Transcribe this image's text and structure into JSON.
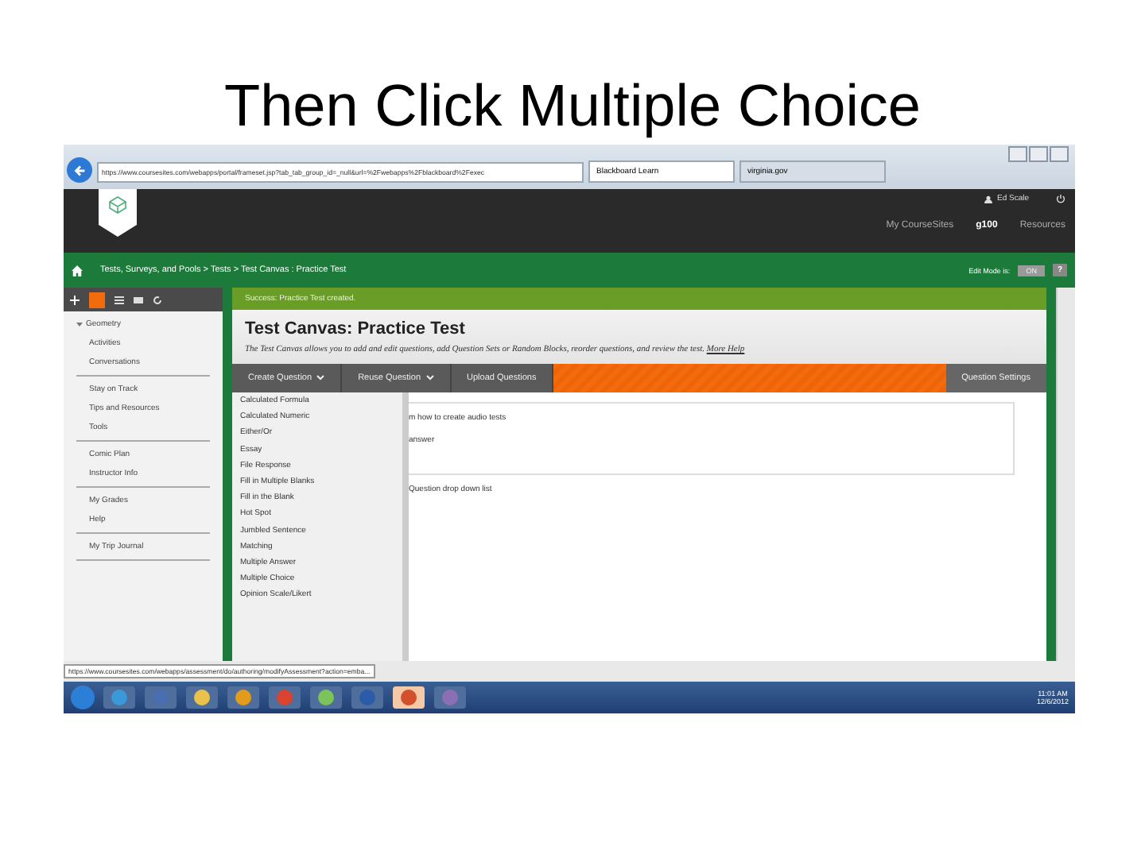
{
  "slide_title": "Then Click Multiple Choice",
  "browser": {
    "url": "https://www.coursesites.com/webapps/portal/frameset.jsp?tab_tab_group_id=_null&url=%2Fwebapps%2Fblackboard%2Fexec",
    "tabs": [
      {
        "label": "Blackboard Learn",
        "selected": true
      },
      {
        "label": "virginia.gov",
        "selected": false
      }
    ]
  },
  "header": {
    "user": "Ed Scale",
    "nav": [
      {
        "label": "My CourseSites",
        "selected": false
      },
      {
        "label": "g100",
        "selected": true
      },
      {
        "label": "Resources",
        "selected": false
      }
    ]
  },
  "breadcrumb": "Tests, Surveys, and Pools  >  Tests  >  Test Canvas : Practice Test",
  "edit_mode": {
    "label": "Edit Mode is:",
    "value": "ON",
    "help": "?"
  },
  "sidebar": {
    "groups": [
      [
        {
          "label": "Geometry",
          "expanded": true,
          "children": [
            {
              "label": "Activities"
            },
            {
              "label": "Conversations"
            }
          ]
        }
      ],
      [
        {
          "label": "Stay on Track"
        },
        {
          "label": "Tips and Resources"
        },
        {
          "label": "Tools"
        }
      ],
      [
        {
          "label": "Comic Plan"
        },
        {
          "label": "Instructor Info"
        }
      ],
      [
        {
          "label": "My Grades"
        },
        {
          "label": "Help"
        }
      ],
      [
        {
          "label": "My Trip Journal"
        }
      ]
    ]
  },
  "success": "Success: Practice Test created.",
  "page_title": "Test Canvas: Practice Test",
  "description": "The Test Canvas allows you to add and edit questions, add Question Sets or Random Blocks, reorder questions, and review the test.",
  "help_link": "More Help",
  "action_bar": {
    "menus": [
      {
        "label": "Create Question",
        "dropdown": true
      },
      {
        "label": "Reuse Question",
        "dropdown": true
      },
      {
        "label": "Upload Questions",
        "dropdown": false
      }
    ],
    "settings": "Question Settings"
  },
  "question_types": [
    "Calculated Formula",
    "Calculated Numeric",
    "Either/Or",
    "Essay",
    "File Response",
    "Fill in Multiple Blanks",
    "Fill in the Blank",
    "Hot Spot",
    "Jumbled Sentence",
    "Matching",
    "Multiple Answer",
    "Multiple Choice",
    "Opinion Scale/Likert"
  ],
  "background_texts": [
    "m how to create audio tests",
    "answer",
    "Question drop down list"
  ],
  "status_url": "https://www.coursesites.com/webapps/assessment/do/authoring/modifyAssessment?action=emba...",
  "taskbar": {
    "time": "11:01 AM",
    "date": "12/6/2012"
  }
}
